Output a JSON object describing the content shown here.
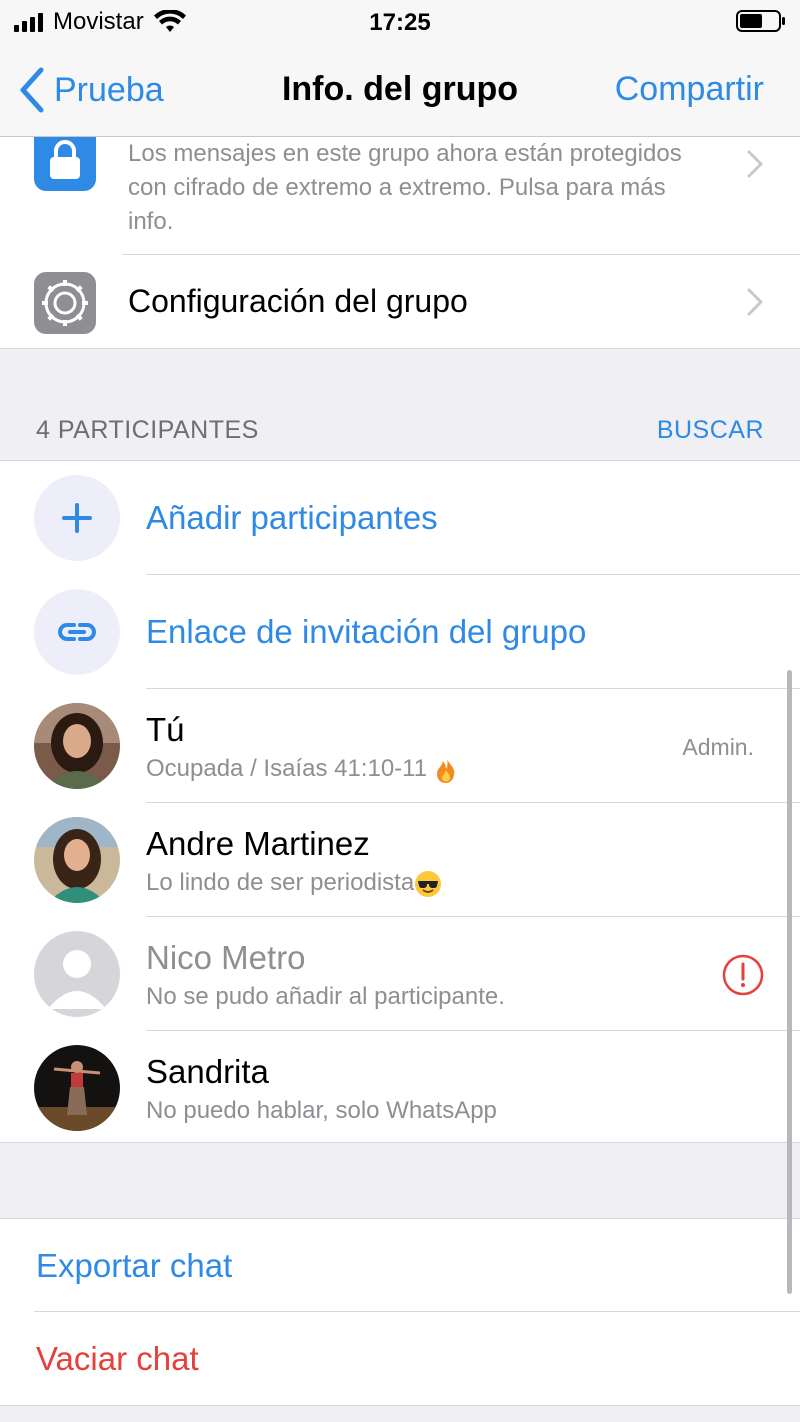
{
  "status_bar": {
    "carrier": "Movistar",
    "time": "17:25",
    "signal_icon": "signal-bars-icon",
    "wifi_icon": "wifi-icon",
    "battery_icon": "battery-icon"
  },
  "nav": {
    "back_label": "Prueba",
    "title": "Info. del grupo",
    "action_label": "Compartir"
  },
  "encryption": {
    "text": "Los mensajes en este grupo ahora están protegidos con cifrado de extremo a extremo. Pulsa para más info.",
    "icon": "lock-icon"
  },
  "config": {
    "label": "Configuración del grupo",
    "icon": "gear-icon"
  },
  "participants_section": {
    "count_label": "4 PARTICIPANTES",
    "search_label": "BUSCAR"
  },
  "actions": {
    "add_participants": "Añadir participantes",
    "invite_link": "Enlace de invitación del grupo"
  },
  "members": [
    {
      "name": "Tú",
      "status": "Ocupada / Isaías 41:10-11",
      "status_emoji": "fire-emoji",
      "role": "Admin."
    },
    {
      "name": "Andre Martinez",
      "status": "Lo lindo de ser periodista",
      "status_emoji": "sunglasses-emoji"
    },
    {
      "name": "Nico Metro",
      "status": "No se pudo añadir al participante.",
      "alert_icon": "alert-icon"
    },
    {
      "name": "Sandrita",
      "status": "No puedo hablar, solo WhatsApp"
    }
  ],
  "chat_actions": {
    "export": "Exportar chat",
    "clear": "Vaciar chat"
  },
  "colors": {
    "accent": "#2f8ae5",
    "destructive": "#e5403a",
    "secondary_text": "#8e8e93",
    "background": "#efeff4"
  }
}
